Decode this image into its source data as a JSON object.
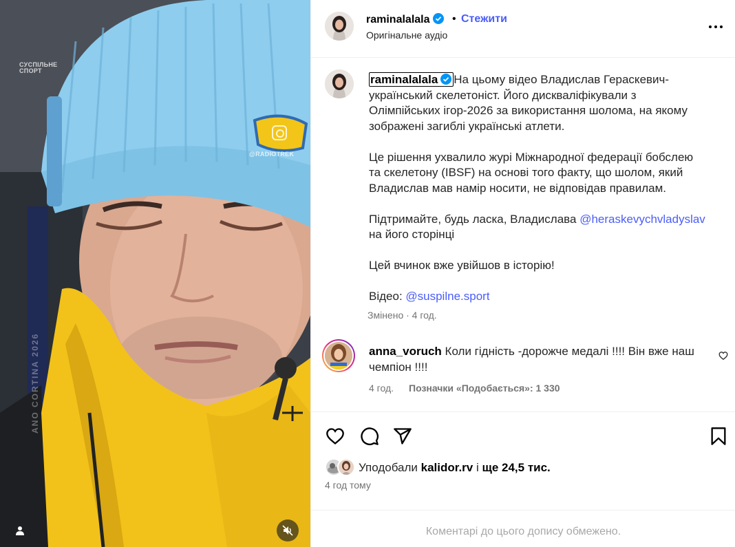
{
  "media": {
    "watermark_top_left": "СУСПІЛЬНЕ СПОРТ",
    "watermark_right": "@RADIOTREK",
    "vertical_banner": "ANO CORTINA 2026",
    "user_tag_icon": "user-tag-icon",
    "mute_icon": "speaker-muted-icon"
  },
  "header": {
    "username": "raminalalala",
    "separator": "•",
    "follow_label": "Стежити",
    "audio_label": "Оригінальне аудіо",
    "more_icon": "more-options-icon"
  },
  "caption": {
    "username": "raminalalala",
    "lines": [
      "На цьому відео Владислав Гераскевич-",
      "український скелетоніст. Його дискваліфікували з",
      "Олімпійських ігор-2026 за використання шолома, на якому",
      "зображені загиблі українські атлети."
    ],
    "para2": [
      "Це рішення ухвалило журі Міжнародної федерації бобслею",
      "та скелетону (IBSF) на основі того факту, що шолом, який",
      "Владислав мав намір носити, не відповідав правилам."
    ],
    "para3_prefix": "Підтримайте, будь ласка, Владислава ",
    "para3_mention": "@heraskevychvladyslav",
    "para3_line2": "на його сторінці",
    "para4": "Цей вчинок вже увійшов в історію!",
    "video_prefix": "Відео: ",
    "video_mention": "@suspilne.sport",
    "meta": "Змінено · 4 год."
  },
  "comment": {
    "username": "anna_voruch",
    "text_line1": "Коли гідність -дорожче медалі !!!! Він вже наш",
    "text_line2": "чемпіон !!!!",
    "time": "4 год.",
    "likes": "Позначки «Подобається»: 1 330",
    "heart_icon": "heart-outline-icon"
  },
  "actions": {
    "like_icon": "heart-outline-icon",
    "comment_icon": "comment-bubble-icon",
    "share_icon": "paper-plane-icon",
    "save_icon": "bookmark-icon"
  },
  "likes": {
    "prefix": "Уподобали ",
    "user": "kalidor.rv",
    "middle": " і ",
    "count": "ще 24,5 тис."
  },
  "post_time": "4 год тому",
  "footer": {
    "text": "Коментарі до цього допису обмежено."
  },
  "colors": {
    "link_blue": "#4a5df9",
    "verified_blue": "#0095f6",
    "muted_gray": "#737373"
  }
}
